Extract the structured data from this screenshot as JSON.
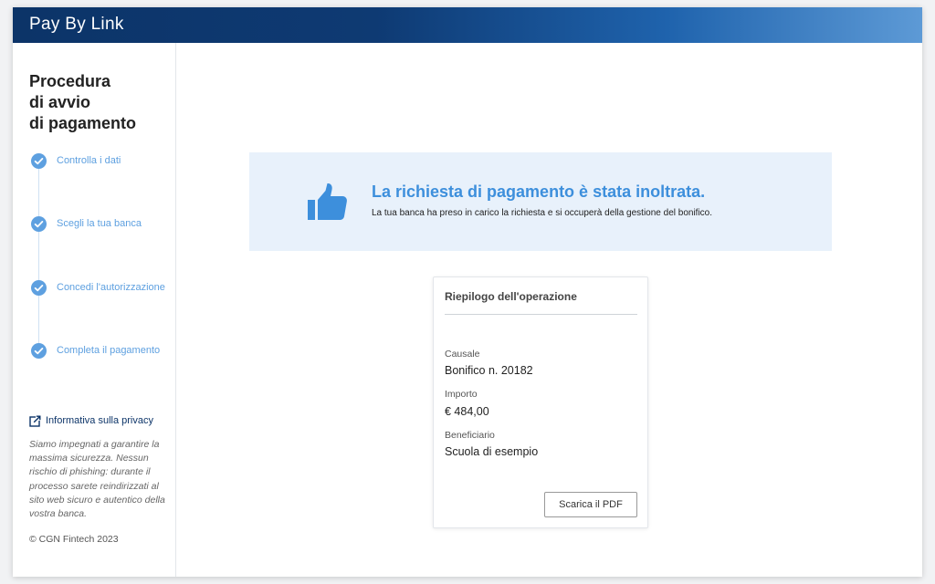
{
  "header": {
    "title": "Pay By Link"
  },
  "sidebar": {
    "title_lines": [
      "Procedura",
      "di avvio",
      "di pagamento"
    ],
    "steps": [
      {
        "label": "Controlla i dati"
      },
      {
        "label": "Scegli la tua banca"
      },
      {
        "label": "Concedi l'autorizzazione"
      },
      {
        "label": "Completa il pagamento"
      }
    ],
    "privacy_link": "Informativa sulla privacy",
    "privacy_text": "Siamo impegnati a garantire la massima sicurezza. Nessun rischio di phishing: durante il processo sarete reindirizzati al sito web sicuro e autentico della vostra banca.",
    "copyright": "© CGN Fintech 2023"
  },
  "banner": {
    "icon": "thumbs-up-icon",
    "title": "La richiesta di pagamento è stata inoltrata.",
    "subtitle": "La tua banca ha preso in carico la richiesta e si occuperà della gestione del bonifico."
  },
  "summary": {
    "title": "Riepilogo dell'operazione",
    "fields": [
      {
        "label": "Causale",
        "value": "Bonifico n. 20182"
      },
      {
        "label": "Importo",
        "value": "€ 484,00"
      },
      {
        "label": "Beneficiario",
        "value": "Scuola di esempio"
      }
    ],
    "download_button": "Scarica il PDF"
  },
  "colors": {
    "header_dark": "#0c3468",
    "header_light": "#5d9ad6",
    "accent": "#3d8fdc",
    "step": "#5ea0e0",
    "banner_bg": "#e8f1fb"
  }
}
